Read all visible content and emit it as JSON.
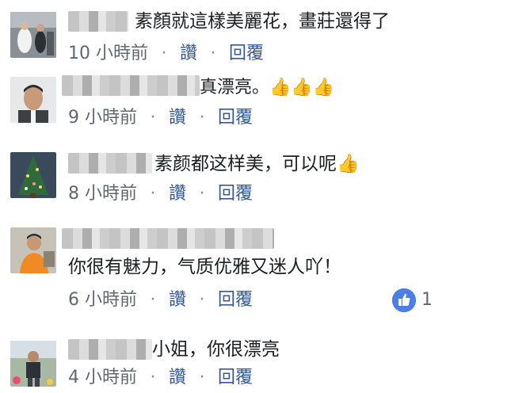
{
  "comments": [
    {
      "text": "素顏就這樣美麗花，畫莊還得了",
      "time": "10 小時前",
      "like_label": "讚",
      "reply_label": "回覆",
      "avatar": "wedding-photo"
    },
    {
      "text": "真漂亮。👍👍👍",
      "time": "9 小時前",
      "like_label": "讚",
      "reply_label": "回覆",
      "avatar": "man-portrait"
    },
    {
      "text": "素颜都这样美，可以呢👍",
      "time": "8 小時前",
      "like_label": "讚",
      "reply_label": "回覆",
      "avatar": "christmas-tree"
    },
    {
      "text": "你很有魅力，气质优雅又迷人吖！",
      "time": "6 小時前",
      "like_label": "讚",
      "reply_label": "回覆",
      "avatar": "man-orange-shirt",
      "reaction_count": "1",
      "reaction_icon": "thumbs-up-icon",
      "reaction_color": "#4a7fe8"
    },
    {
      "text": "小姐，你很漂亮",
      "time": "4 小時前",
      "like_label": "讚",
      "reply_label": "回覆",
      "avatar": "man-outdoor"
    }
  ],
  "separator": "·"
}
